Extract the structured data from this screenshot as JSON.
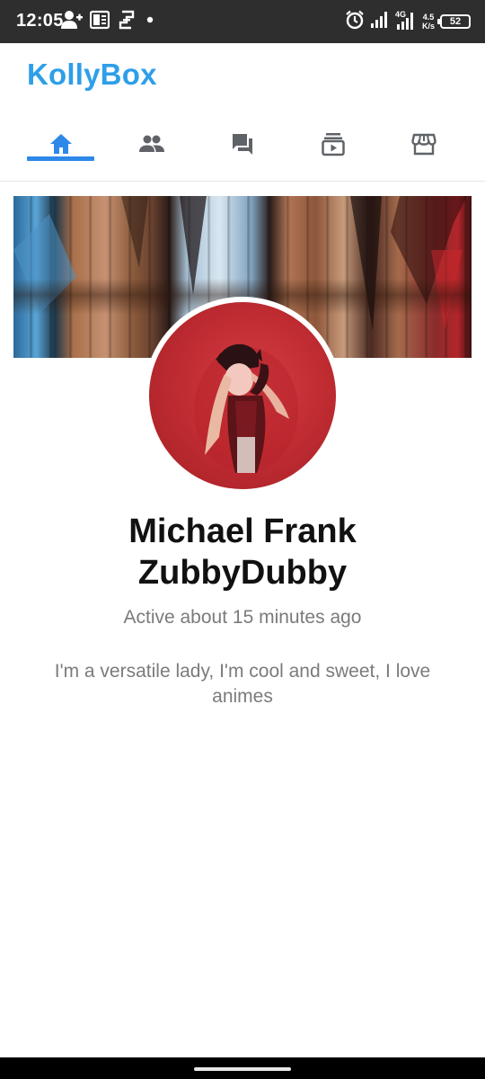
{
  "status_bar": {
    "time": "12:05",
    "network": "4G",
    "net_speed_value": "4.5",
    "net_speed_unit": "K/s",
    "battery": "52",
    "icons_left": [
      "add-person-icon",
      "powerpoint-icon",
      "app-icon",
      "dot-icon"
    ],
    "icons_right": [
      "alarm-icon",
      "signal-icon",
      "signal-4g-icon",
      "battery-icon"
    ]
  },
  "app": {
    "title": "KollyBox",
    "accent_color": "#2e9fe8"
  },
  "nav": {
    "items": [
      {
        "icon": "home-icon",
        "active": true
      },
      {
        "icon": "people-icon",
        "active": false
      },
      {
        "icon": "chat-icon",
        "active": false
      },
      {
        "icon": "video-library-icon",
        "active": false
      },
      {
        "icon": "store-icon",
        "active": false
      }
    ],
    "active_color": "#2e88e8",
    "inactive_color": "#5f6368"
  },
  "profile": {
    "name_line1": "Michael Frank",
    "name_line2": "ZubbyDubby",
    "active_status": "Active about 15 minutes ago",
    "bio": "I'm a versatile lady, I'm cool and sweet, I love animes"
  }
}
